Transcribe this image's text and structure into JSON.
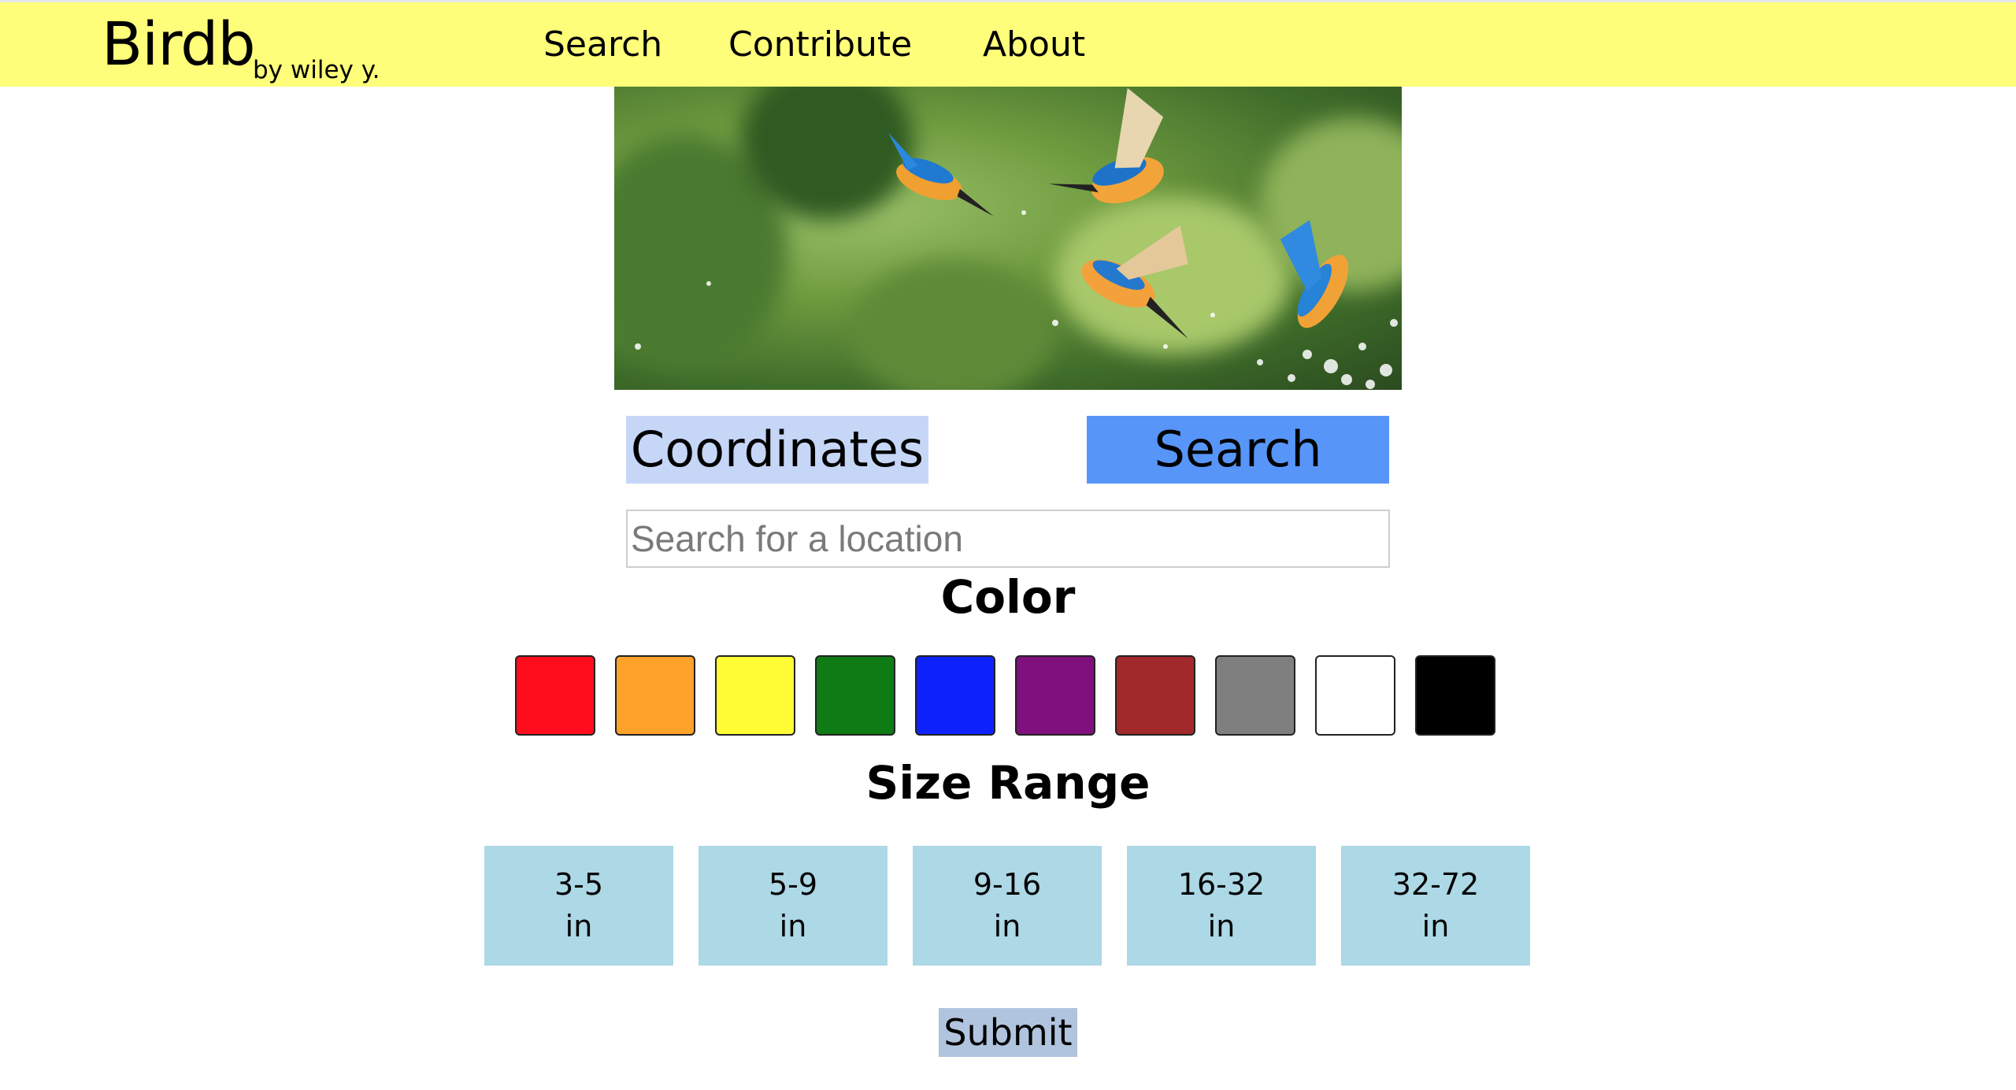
{
  "header": {
    "brand": "Birdb",
    "brand_sub": "by wiley y.",
    "nav": [
      {
        "label": "Search"
      },
      {
        "label": "Contribute"
      },
      {
        "label": "About"
      }
    ]
  },
  "mode": {
    "coordinates_label": "Coordinates",
    "search_label": "Search",
    "active": "Search"
  },
  "location": {
    "placeholder": "Search for a location",
    "value": ""
  },
  "color_section": {
    "title": "Color",
    "swatches": [
      {
        "name": "red",
        "hex": "#ff0d1d"
      },
      {
        "name": "orange",
        "hex": "#fda22a"
      },
      {
        "name": "yellow",
        "hex": "#fffc36"
      },
      {
        "name": "green",
        "hex": "#0f7b14"
      },
      {
        "name": "blue",
        "hex": "#0e23fb"
      },
      {
        "name": "purple",
        "hex": "#7f107d"
      },
      {
        "name": "brown",
        "hex": "#a1292b"
      },
      {
        "name": "gray",
        "hex": "#7f7f7f"
      },
      {
        "name": "white",
        "hex": "#ffffff"
      },
      {
        "name": "black",
        "hex": "#000000"
      }
    ]
  },
  "size_section": {
    "title": "Size Range",
    "ranges": [
      {
        "range": "3-5",
        "unit": "in"
      },
      {
        "range": "5-9",
        "unit": "in"
      },
      {
        "range": "9-16",
        "unit": "in"
      },
      {
        "range": "16-32",
        "unit": "in"
      },
      {
        "range": "32-72",
        "unit": "in"
      }
    ]
  },
  "submit_label": "Submit",
  "colors": {
    "header_bg": "#fefe7a",
    "coords_bg": "#c6d6f7",
    "search_bg": "#5796f8",
    "size_bg": "#add8e6",
    "submit_bg": "#b0c4de"
  }
}
